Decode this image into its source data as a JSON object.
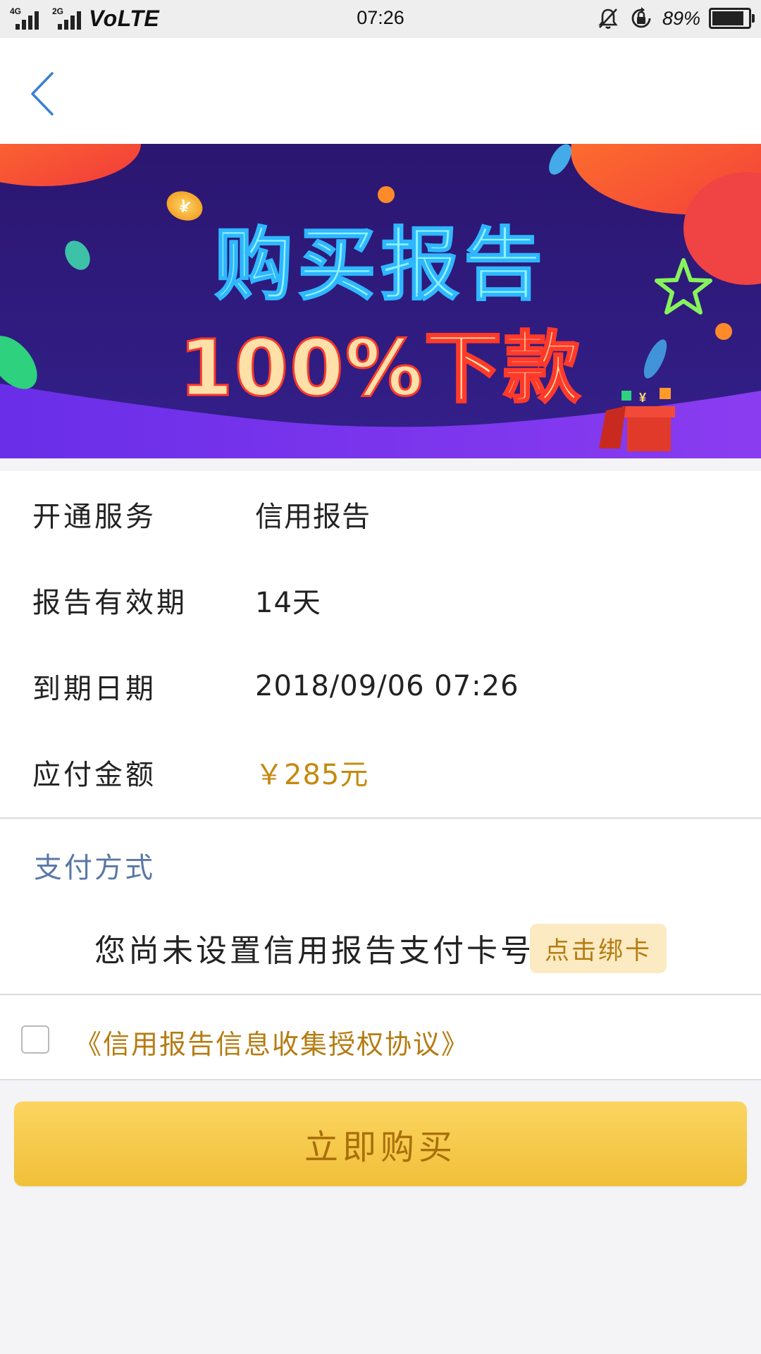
{
  "status_bar": {
    "network_tag_1": "4G",
    "network_tag_2": "2G",
    "volte": "VoLTE",
    "time": "07:26",
    "battery_percent": "89%",
    "battery_level": 0.89,
    "icons": [
      "signal-4g-icon",
      "signal-2g-icon",
      "bell-mute-icon",
      "rotation-lock-icon",
      "battery-icon"
    ]
  },
  "nav": {
    "back_icon": "chevron-left-icon",
    "accent_color": "#3a7fd5"
  },
  "banner": {
    "title": "购买报告",
    "subtitle": "100%下款",
    "coin_symbol": "¥",
    "colors": {
      "background": "#2c1a78",
      "title": "#8ef3ff",
      "subtitle": "#ffe0a8"
    }
  },
  "info": {
    "rows": [
      {
        "label": "开通服务",
        "value": "信用报告"
      },
      {
        "label": "报告有效期",
        "value": "14天"
      },
      {
        "label": "到期日期",
        "value": "2018/09/06 07:26"
      },
      {
        "label": "应付金额",
        "value": "￥285元"
      }
    ],
    "amount_color": "#c48a10"
  },
  "payment": {
    "title": "支付方式",
    "message": "您尚未设置信用报告支付卡号",
    "bind_button": "点击绑卡"
  },
  "agreement": {
    "checked": false,
    "link_text": "《信用报告信息收集授权协议》"
  },
  "buy_button": {
    "label": "立即购买",
    "color": "#f5c744"
  }
}
